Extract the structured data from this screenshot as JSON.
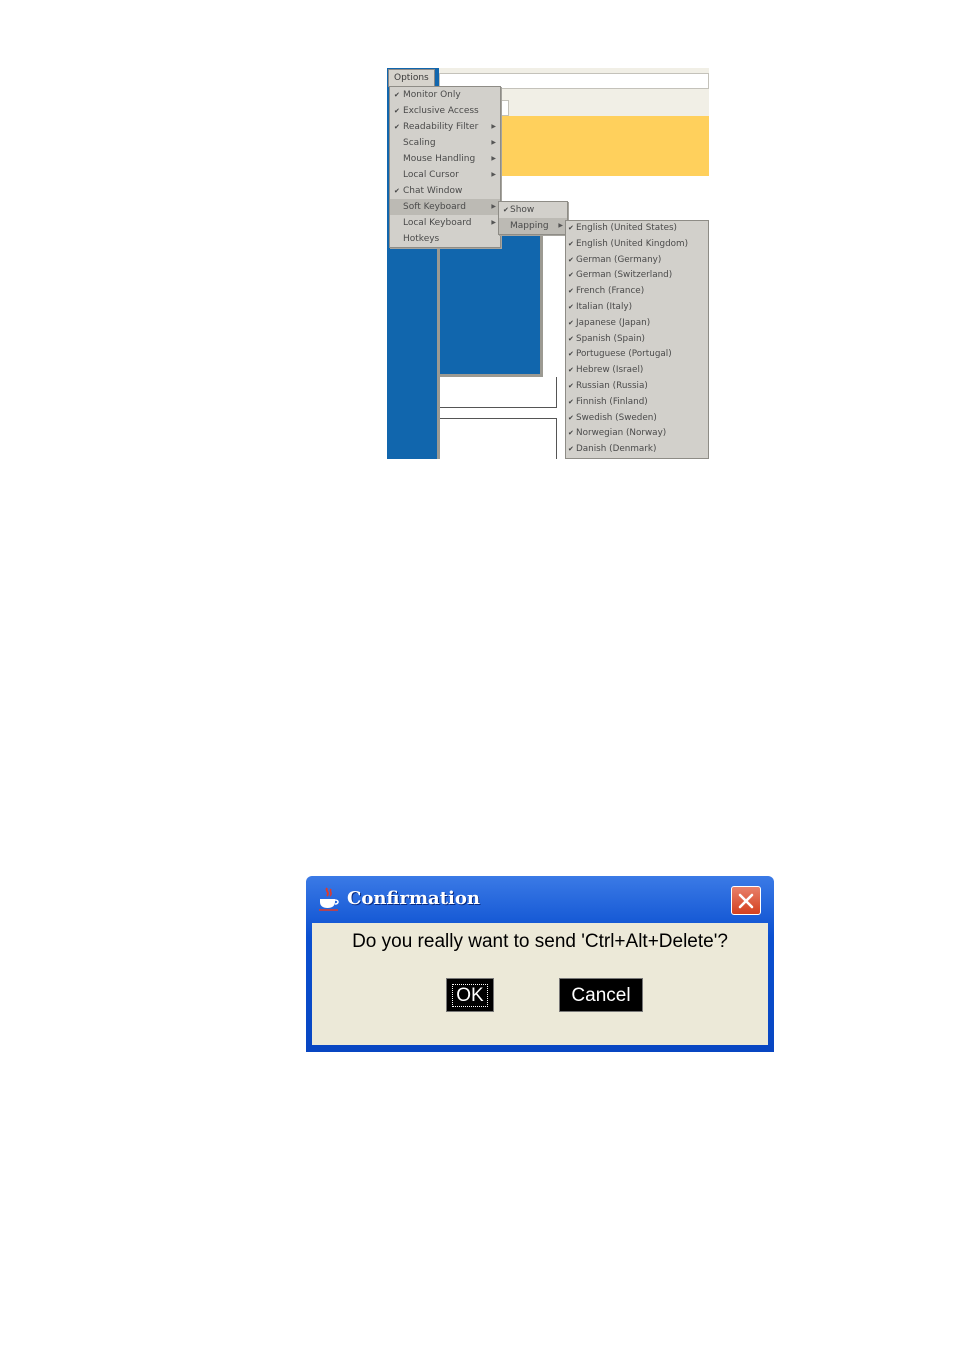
{
  "options_menu": {
    "title": "Options",
    "items": [
      {
        "label": "Monitor Only",
        "checked": true,
        "submenu": false
      },
      {
        "label": "Exclusive Access",
        "checked": true,
        "submenu": false
      },
      {
        "label": "Readability Filter",
        "checked": true,
        "submenu": true
      },
      {
        "label": "Scaling",
        "checked": false,
        "submenu": true
      },
      {
        "label": "Mouse Handling",
        "checked": false,
        "submenu": true
      },
      {
        "label": "Local Cursor",
        "checked": false,
        "submenu": true
      },
      {
        "label": "Chat Window",
        "checked": true,
        "submenu": false
      },
      {
        "label": "Soft Keyboard",
        "checked": false,
        "submenu": true
      },
      {
        "label": "Local Keyboard",
        "checked": false,
        "submenu": true
      },
      {
        "label": "Hotkeys",
        "checked": false,
        "submenu": false
      }
    ]
  },
  "soft_keyboard_menu": {
    "items": [
      {
        "label": "Show",
        "checked": true,
        "submenu": false
      },
      {
        "label": "Mapping",
        "checked": false,
        "submenu": true
      }
    ]
  },
  "mapping_menu": {
    "items": [
      "English (United States)",
      "English (United Kingdom)",
      "German (Germany)",
      "German (Switzerland)",
      "French (France)",
      "Italian (Italy)",
      "Japanese (Japan)",
      "Spanish (Spain)",
      "Portuguese (Portugal)",
      "Hebrew (Israel)",
      "Russian (Russia)",
      "Finnish (Finland)",
      "Swedish (Sweden)",
      "Norwegian (Norway)",
      "Danish (Denmark)"
    ]
  },
  "dialog": {
    "title": "Confirmation",
    "message": "Do you really want to send 'Ctrl+Alt+Delete'?",
    "ok_label": "OK",
    "cancel_label": "Cancel",
    "close_icon": "close-icon",
    "app_icon": "java-cup-icon"
  },
  "colors": {
    "desktop_blue": "#1166ad",
    "highlight_yellow": "#ffd05c",
    "menu_gray": "#d2d0cb",
    "titlebar_blue": "#0a4fd0",
    "dialog_body": "#ece9d8"
  }
}
